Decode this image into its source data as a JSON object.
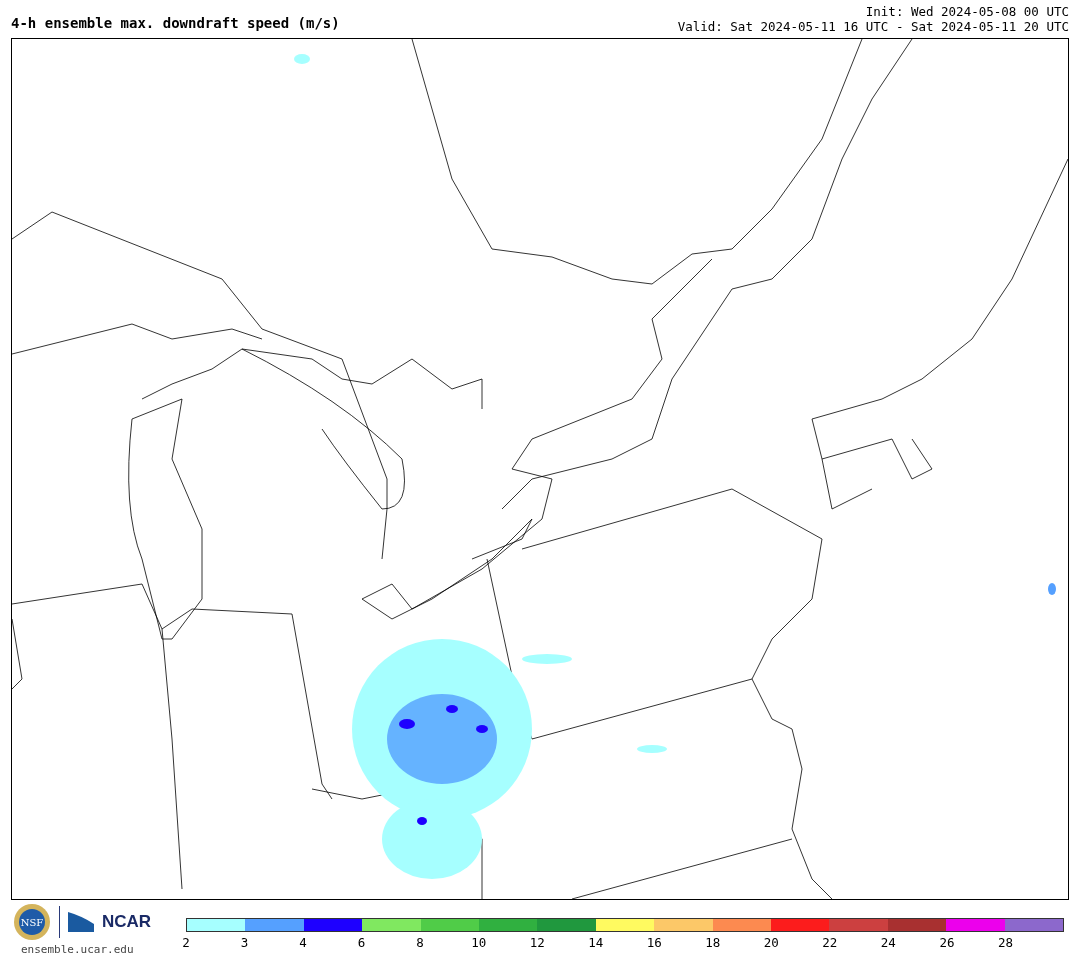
{
  "header": {
    "title": "4-h ensemble max. downdraft speed (m/s)",
    "init": "Init: Wed 2024-05-08 00 UTC",
    "valid": "Valid: Sat 2024-05-11 16 UTC - Sat 2024-05-11 20 UTC"
  },
  "footer": {
    "nsf_logo_text": "NSF",
    "ncar_logo_text": "NCAR",
    "url": "ensemble.ucar.edu"
  },
  "colorbar": {
    "bins": [
      {
        "label": "2",
        "color": "#a6ffff"
      },
      {
        "label": "3",
        "color": "#55a0ff"
      },
      {
        "label": "4",
        "color": "#1e00ff"
      },
      {
        "label": "6",
        "color": "#80e860"
      },
      {
        "label": "8",
        "color": "#50cc48"
      },
      {
        "label": "10",
        "color": "#30b040"
      },
      {
        "label": "12",
        "color": "#20983e"
      },
      {
        "label": "14",
        "color": "#fffa60"
      },
      {
        "label": "16",
        "color": "#fcc868"
      },
      {
        "label": "18",
        "color": "#fc8a50"
      },
      {
        "label": "20",
        "color": "#fc1c1c"
      },
      {
        "label": "22",
        "color": "#cc4040"
      },
      {
        "label": "24",
        "color": "#a83030"
      },
      {
        "label": "26",
        "color": "#ec00ec"
      },
      {
        "label": "28",
        "color": "#8c68cc"
      }
    ]
  }
}
